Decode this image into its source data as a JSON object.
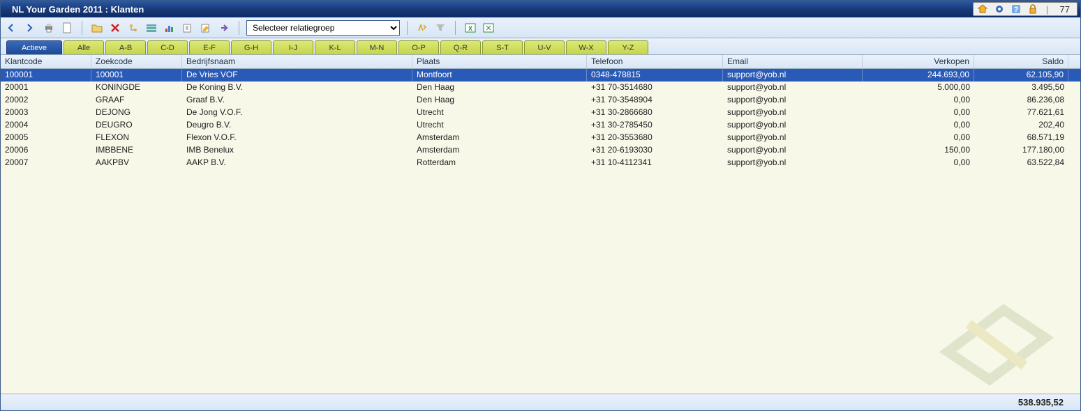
{
  "window": {
    "title": "NL Your Garden 2011 : Klanten",
    "record_count": "77"
  },
  "toolbar": {
    "select_placeholder": "Selecteer relatiegroep"
  },
  "filters": [
    {
      "label": "Actieve",
      "active": true
    },
    {
      "label": "Alle"
    },
    {
      "label": "A-B"
    },
    {
      "label": "C-D"
    },
    {
      "label": "E-F"
    },
    {
      "label": "G-H"
    },
    {
      "label": "I-J"
    },
    {
      "label": "K-L"
    },
    {
      "label": "M-N"
    },
    {
      "label": "O-P"
    },
    {
      "label": "Q-R"
    },
    {
      "label": "S-T"
    },
    {
      "label": "U-V"
    },
    {
      "label": "W-X"
    },
    {
      "label": "Y-Z"
    }
  ],
  "columns": {
    "klantcode": "Klantcode",
    "zoekcode": "Zoekcode",
    "bedrijfsnaam": "Bedrijfsnaam",
    "plaats": "Plaats",
    "telefoon": "Telefoon",
    "email": "Email",
    "verkopen": "Verkopen",
    "saldo": "Saldo"
  },
  "rows": [
    {
      "klantcode": "100001",
      "zoekcode": "100001",
      "bedrijfsnaam": "De Vries VOF",
      "plaats": "Montfoort",
      "telefoon": "0348-478815",
      "email": "support@yob.nl",
      "verkopen": "244.693,00",
      "saldo": "62.105,90",
      "selected": true
    },
    {
      "klantcode": "20001",
      "zoekcode": "KONINGDE",
      "bedrijfsnaam": "De Koning B.V.",
      "plaats": "Den Haag",
      "telefoon": "+31 70-3514680",
      "email": "support@yob.nl",
      "verkopen": "5.000,00",
      "saldo": "3.495,50"
    },
    {
      "klantcode": "20002",
      "zoekcode": "GRAAF",
      "bedrijfsnaam": "Graaf B.V.",
      "plaats": "Den Haag",
      "telefoon": "+31 70-3548904",
      "email": "support@yob.nl",
      "verkopen": "0,00",
      "saldo": "86.236,08"
    },
    {
      "klantcode": "20003",
      "zoekcode": "DEJONG",
      "bedrijfsnaam": "De Jong V.O.F.",
      "plaats": "Utrecht",
      "telefoon": "+31 30-2866680",
      "email": "support@yob.nl",
      "verkopen": "0,00",
      "saldo": "77.621,61"
    },
    {
      "klantcode": "20004",
      "zoekcode": "DEUGRO",
      "bedrijfsnaam": "Deugro B.V.",
      "plaats": "Utrecht",
      "telefoon": "+31 30-2785450",
      "email": "support@yob.nl",
      "verkopen": "0,00",
      "saldo": "202,40"
    },
    {
      "klantcode": "20005",
      "zoekcode": "FLEXON",
      "bedrijfsnaam": "Flexon V.O.F.",
      "plaats": "Amsterdam",
      "telefoon": "+31 20-3553680",
      "email": "support@yob.nl",
      "verkopen": "0,00",
      "saldo": "68.571,19"
    },
    {
      "klantcode": "20006",
      "zoekcode": "IMBBENE",
      "bedrijfsnaam": "IMB Benelux",
      "plaats": "Amsterdam",
      "telefoon": "+31 20-6193030",
      "email": "support@yob.nl",
      "verkopen": "150,00",
      "saldo": "177.180,00"
    },
    {
      "klantcode": "20007",
      "zoekcode": "AAKPBV",
      "bedrijfsnaam": "AAKP B.V.",
      "plaats": "Rotterdam",
      "telefoon": "+31 10-4112341",
      "email": "support@yob.nl",
      "verkopen": "0,00",
      "saldo": "63.522,84"
    }
  ],
  "footer": {
    "total": "538.935,52"
  }
}
